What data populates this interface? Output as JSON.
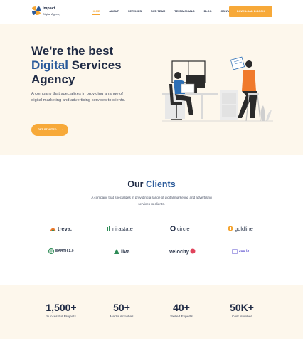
{
  "brand": {
    "name": "Impact",
    "tagline": "Digital Agency"
  },
  "nav": {
    "items": [
      {
        "label": "HOME",
        "active": true
      },
      {
        "label": "ABOUT",
        "active": false
      },
      {
        "label": "SERVICES",
        "active": false
      },
      {
        "label": "OUR TEAM",
        "active": false
      },
      {
        "label": "TESTIMONIALS",
        "active": false
      },
      {
        "label": "BLOG",
        "active": false
      },
      {
        "label": "CONTACT",
        "active": false
      }
    ],
    "cta_label": "DOWNLOAD E-BOOK"
  },
  "hero": {
    "title_line1": "We're the best",
    "title_accent": "Digital",
    "title_line2_rest": " Services",
    "title_line3": "Agency",
    "description": "A company that specializes in providing a range of digital marketing and advertising services to clients.",
    "button_label": "GET STARTED",
    "button_arrow": "→"
  },
  "clients": {
    "title_part1": "Our ",
    "title_accent": "Clients",
    "description": "A company that specializes in providing a range of digital marketing and advertising services to clients.",
    "logos": [
      {
        "name": "treva.",
        "icon": "treva-logo-icon"
      },
      {
        "name": "nirastate",
        "icon": "nirastate-logo-icon"
      },
      {
        "name": "circle",
        "icon": "circle-logo-icon"
      },
      {
        "name": "goldline",
        "icon": "goldline-logo-icon"
      },
      {
        "name": "EARTH 2.0",
        "icon": "earth-logo-icon"
      },
      {
        "name": "liva",
        "icon": "liva-logo-icon"
      },
      {
        "name": "velocity",
        "icon": "velocity-logo-icon"
      },
      {
        "name": "zoo tv",
        "icon": "zootv-logo-icon"
      }
    ]
  },
  "stats": [
    {
      "value": "1,500+",
      "label": "Successful Projects"
    },
    {
      "value": "50+",
      "label": "Media Activities"
    },
    {
      "value": "40+",
      "label": "Skilled Experts"
    },
    {
      "value": "50K+",
      "label": "Cost Number"
    }
  ],
  "colors": {
    "accent": "#f7a939",
    "brand_blue": "#2a5a9a",
    "heading": "#1f2a44",
    "hero_bg": "#fdf7ec"
  }
}
